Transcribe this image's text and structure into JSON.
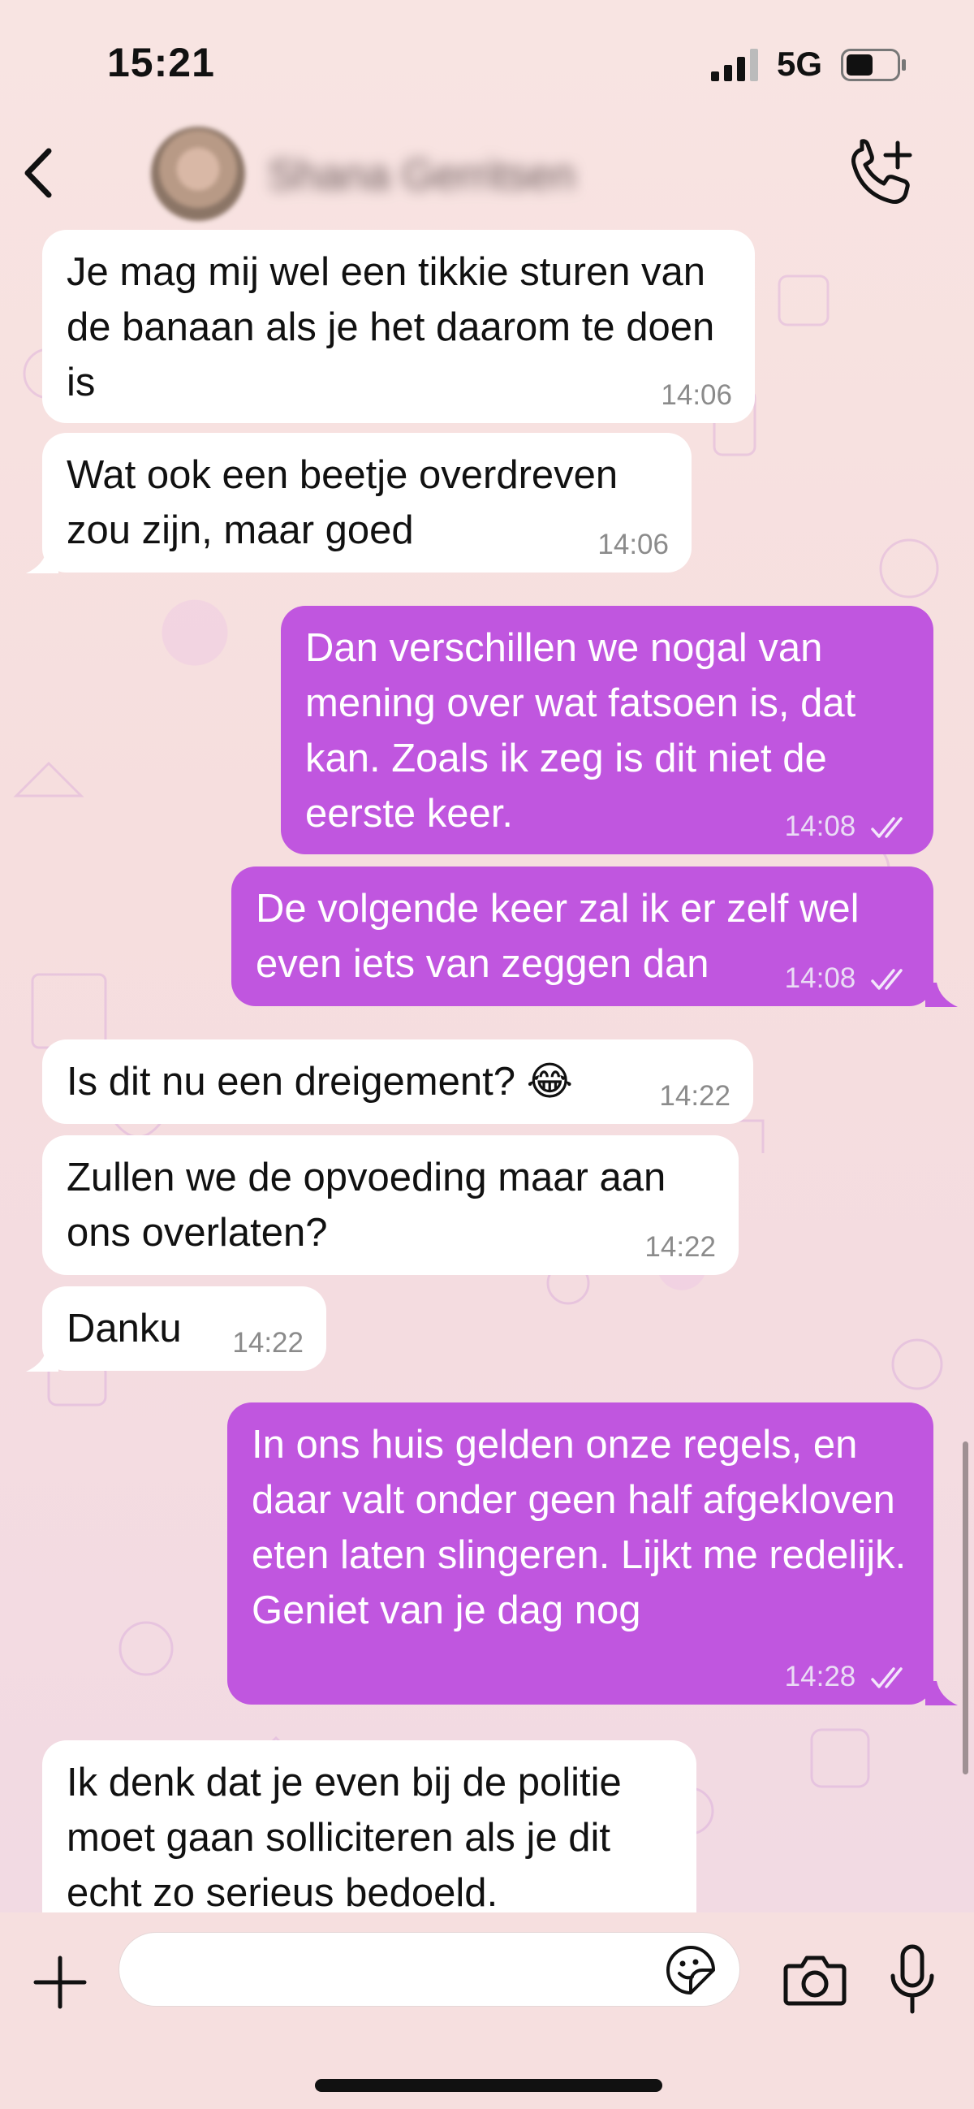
{
  "status_bar": {
    "time": "15:21",
    "network": "5G"
  },
  "header": {
    "contact_name": "Shana Gerritsen",
    "icons": [
      "back-icon",
      "add-call-icon"
    ]
  },
  "messages": [
    {
      "direction": "incoming",
      "text": "Je mag mij wel een tikkie sturen van de banaan als je het daarom te doen is",
      "time": "14:06"
    },
    {
      "direction": "incoming",
      "text": "Wat ook een beetje overdreven zou zijn, maar goed",
      "time": "14:06"
    },
    {
      "direction": "outgoing",
      "text": "Dan verschillen we nogal van mening over wat fatsoen is, dat kan. Zoals ik zeg is dit niet de eerste keer.",
      "time": "14:08",
      "status": "read"
    },
    {
      "direction": "outgoing",
      "text": "De volgende keer zal ik er zelf wel even iets van zeggen dan",
      "time": "14:08",
      "status": "read"
    },
    {
      "direction": "incoming",
      "text": "Is dit nu een dreigement? 😂",
      "time": "14:22"
    },
    {
      "direction": "incoming",
      "text": "Zullen we de opvoeding maar aan ons overlaten?",
      "time": "14:22"
    },
    {
      "direction": "incoming",
      "text": "Danku",
      "time": "14:22"
    },
    {
      "direction": "outgoing",
      "text": "In ons huis gelden onze regels, en daar valt onder geen half afgekloven eten laten slingeren. Lijkt me redelijk. Geniet van je dag nog",
      "time": "14:28",
      "status": "read"
    },
    {
      "direction": "incoming",
      "text": "Ik denk dat je even bij de politie moet gaan solliciteren als je dit echt zo serieus bedoeld.",
      "time": ""
    }
  ],
  "composer": {
    "placeholder": "",
    "icons": [
      "plus-icon",
      "sticker-icon",
      "camera-icon",
      "microphone-icon"
    ]
  },
  "colors": {
    "outgoing_bubble": "#c056df",
    "incoming_bubble": "#ffffff",
    "background": "#f6dfe0"
  }
}
